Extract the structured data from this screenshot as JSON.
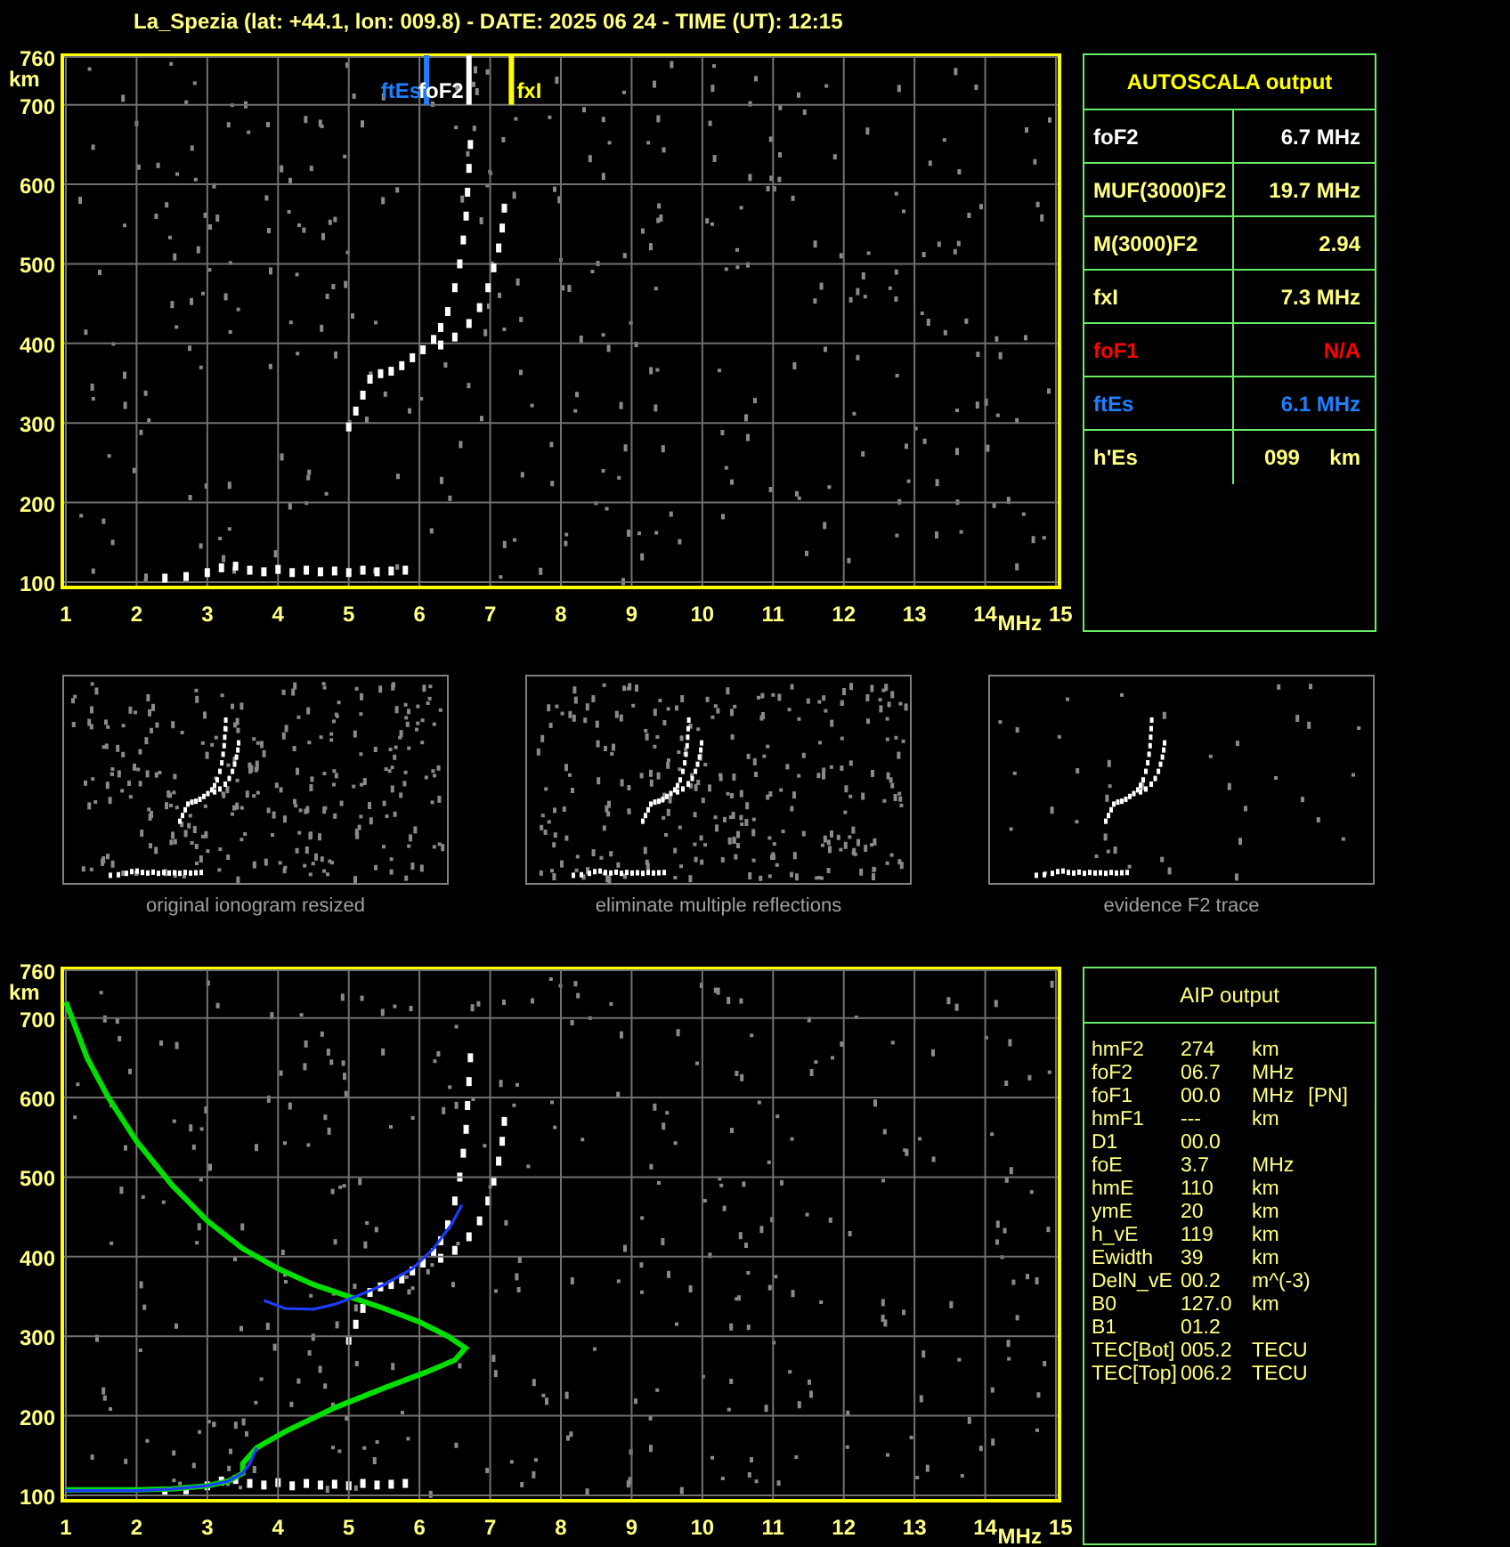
{
  "header": {
    "title": "La_Spezia (lat: +44.1, lon: 009.8) - DATE: 2025 06 24 - TIME (UT): 12:15"
  },
  "ionogram": {
    "chart_data": {
      "type": "scatter",
      "xlabel": "MHz",
      "ylabel": "km",
      "xlim": [
        1,
        15
      ],
      "ylim": [
        100,
        760
      ],
      "xticks": [
        1,
        2,
        3,
        4,
        5,
        6,
        7,
        8,
        9,
        10,
        11,
        12,
        13,
        14,
        15
      ],
      "yticks": [
        100,
        200,
        300,
        400,
        500,
        600,
        700,
        760
      ],
      "series": [
        {
          "color": "#ffffff",
          "x": [
            5.0,
            5.1,
            5.2,
            5.3,
            5.45,
            5.6,
            5.75,
            5.9,
            6.05,
            6.2,
            6.3,
            6.4,
            6.5,
            6.57,
            6.62,
            6.66,
            6.68,
            6.7,
            6.72
          ],
          "values": [
            295,
            315,
            335,
            355,
            362,
            365,
            372,
            382,
            392,
            405,
            420,
            440,
            470,
            500,
            530,
            560,
            590,
            620,
            650
          ]
        },
        {
          "color": "#ffffff",
          "x": [
            6.3,
            6.5,
            6.7,
            6.85,
            6.97,
            7.05,
            7.12,
            7.17,
            7.2
          ],
          "values": [
            398,
            408,
            425,
            445,
            470,
            495,
            520,
            545,
            570
          ]
        },
        {
          "color": "#ffffff",
          "x": [
            2.4,
            2.7,
            3.0,
            3.2,
            3.4,
            3.6,
            3.8,
            4.0,
            4.2,
            4.4,
            4.6,
            4.8,
            5.0,
            5.2,
            5.4,
            5.6,
            5.8
          ],
          "values": [
            105,
            107,
            112,
            118,
            120,
            115,
            113,
            116,
            112,
            115,
            113,
            114,
            112,
            115,
            113,
            114,
            115
          ]
        }
      ],
      "grid": true
    },
    "markers": [
      {
        "label": "ftEs",
        "color": "#1e7fff"
      },
      {
        "label": "foF2",
        "color": "#ffffff"
      },
      {
        "label": "fxI",
        "color": "#ffff00"
      }
    ]
  },
  "autoscala": {
    "title": "AUTOSCALA output",
    "rows": [
      {
        "label": "foF2",
        "value": "6.7 MHz",
        "color": "#ffffff"
      },
      {
        "label": "MUF(3000)F2",
        "value": "19.7 MHz",
        "color": "#ffff80"
      },
      {
        "label": "M(3000)F2",
        "value": "2.94",
        "color": "#ffff80"
      },
      {
        "label": "fxI",
        "value": "7.3 MHz",
        "color": "#ffff80"
      },
      {
        "label": "foF1",
        "value": "N/A",
        "color": "#ff0000"
      },
      {
        "label": "ftEs",
        "value": "6.1 MHz",
        "color": "#1e7fff"
      },
      {
        "label": "h'Es",
        "value": "099     km",
        "color": "#ffff80"
      }
    ]
  },
  "thumbnails": [
    {
      "caption": "original ionogram resized"
    },
    {
      "caption": "eliminate multiple reflections"
    },
    {
      "caption": "evidence F2 trace"
    }
  ],
  "aip_ionogram": {
    "chart_data": {
      "type": "line",
      "grid": true,
      "xlabel": "MHz",
      "ylabel": "km",
      "xlim": [
        1,
        15
      ],
      "ylim": [
        100,
        760
      ],
      "xticks": [
        1,
        2,
        3,
        4,
        5,
        6,
        7,
        8,
        9,
        10,
        11,
        12,
        13,
        14,
        15
      ],
      "yticks": [
        100,
        200,
        300,
        400,
        500,
        600,
        700,
        760
      ],
      "series": [
        {
          "color": "#00e000",
          "x": [
            1,
            1.3,
            1.6,
            2,
            2.5,
            3,
            3.5,
            4,
            4.5,
            5,
            5.5,
            6,
            6.4,
            6.65,
            6.5,
            6.1,
            5.5,
            4.8,
            4.1,
            3.7,
            3.5,
            3.5,
            3.3,
            3.0,
            2.5,
            2,
            1
          ],
          "values": [
            720,
            650,
            600,
            545,
            490,
            445,
            410,
            385,
            365,
            350,
            335,
            318,
            300,
            285,
            270,
            255,
            235,
            210,
            180,
            160,
            140,
            128,
            118,
            112,
            108,
            107,
            107
          ]
        },
        {
          "color": "#1e3cff",
          "x": [
            1,
            1.5,
            2,
            2.5,
            3,
            3.3,
            3.5,
            3.6,
            3.7
          ],
          "values": [
            106,
            106,
            106,
            108,
            112,
            118,
            128,
            140,
            160
          ]
        },
        {
          "color": "#1e3cff",
          "x": [
            3.8,
            4.1,
            4.5,
            4.8,
            5.1,
            5.5,
            5.9,
            6.2,
            6.45,
            6.6
          ],
          "values": [
            345,
            335,
            334,
            340,
            350,
            365,
            385,
            410,
            440,
            465
          ]
        }
      ]
    }
  },
  "aip": {
    "title": "AIP output",
    "rows": [
      {
        "label": "hmF2",
        "value": "274",
        "unit": "km"
      },
      {
        "label": "foF2",
        "value": "06.7",
        "unit": "MHz"
      },
      {
        "label": "foF1",
        "value": "00.0",
        "unit": "MHz",
        "note": "[PN]"
      },
      {
        "label": "hmF1",
        "value": "---",
        "unit": "km"
      },
      {
        "label": "D1",
        "value": "00.0"
      },
      {
        "label": "foE",
        "value": "3.7",
        "unit": "MHz"
      },
      {
        "label": "hmE",
        "value": "110",
        "unit": "km"
      },
      {
        "label": "ymE",
        "value": "20",
        "unit": "km"
      },
      {
        "label": "h_vE",
        "value": "119",
        "unit": "km"
      },
      {
        "label": "Ewidth",
        "value": "39",
        "unit": "km"
      },
      {
        "label": "DelN_vE",
        "value": "00.2",
        "unit": "m^(-3)"
      },
      {
        "label": "B0",
        "value": "127.0",
        "unit": "km"
      },
      {
        "label": "B1",
        "value": "01.2"
      },
      {
        "label": "TEC[Bot]",
        "value": "005.2",
        "unit": "TECU"
      },
      {
        "label": "TEC[Top]",
        "value": "006.2",
        "unit": "TECU"
      }
    ]
  }
}
